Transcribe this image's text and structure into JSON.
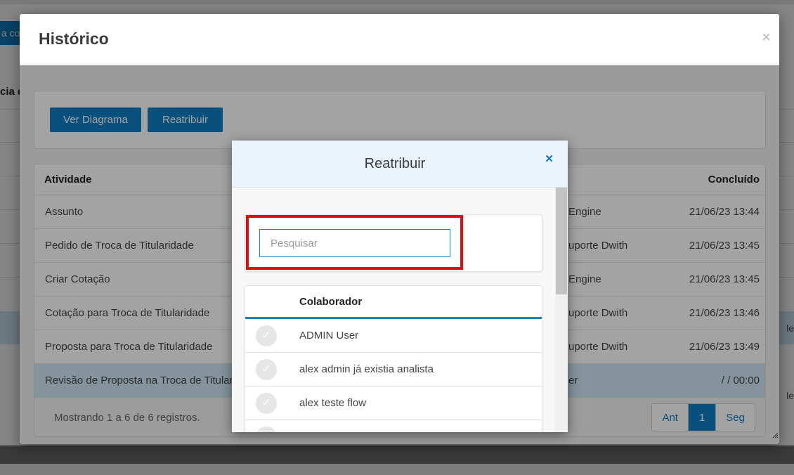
{
  "background": {
    "button_label": "a co",
    "header_label": "cia d",
    "side_texts": [
      "le",
      "le"
    ]
  },
  "historico": {
    "title": "Histórico",
    "close_icon": "×",
    "buttons": {
      "ver_diagrama": "Ver Diagrama",
      "reatribuir": "Reatribuir"
    },
    "table": {
      "columns": {
        "atividade": "Atividade",
        "concluido": "Concluído"
      },
      "rows": [
        {
          "atividade": "Assunto",
          "middle": "Engine",
          "concluido": "21/06/23 13:44"
        },
        {
          "atividade": "Pedido de Troca de Titularidade",
          "middle": "uporte Dwith",
          "concluido": "21/06/23 13:45"
        },
        {
          "atividade": "Criar Cotação",
          "middle": "Engine",
          "concluido": "21/06/23 13:45"
        },
        {
          "atividade": "Cotação para Troca de Titularidade",
          "middle": "uporte Dwith",
          "concluido": "21/06/23 13:46"
        },
        {
          "atividade": "Proposta para Troca de Titularidade",
          "middle": "uporte Dwith",
          "concluido": "21/06/23 13:49"
        },
        {
          "atividade": "Revisão de Proposta na Troca de Titularidade",
          "middle": "er",
          "concluido": "/ / 00:00"
        }
      ],
      "footer_info": "Mostrando 1 a 6 de 6 registros.",
      "pager": {
        "prev": "Ant",
        "current": "1",
        "next": "Seg"
      }
    }
  },
  "reatribuir": {
    "title": "Reatribuir",
    "close_icon": "×",
    "search": {
      "placeholder": "Pesquisar",
      "value": ""
    },
    "list": {
      "header": "Colaborador",
      "items": [
        {
          "label": "ADMIN User"
        },
        {
          "label": "alex admin já existia analista"
        },
        {
          "label": "alex teste flow"
        }
      ]
    }
  },
  "colors": {
    "primary": "#0f7dc2",
    "highlight": "#e20d0d",
    "selected_row": "#cfe6f5"
  }
}
